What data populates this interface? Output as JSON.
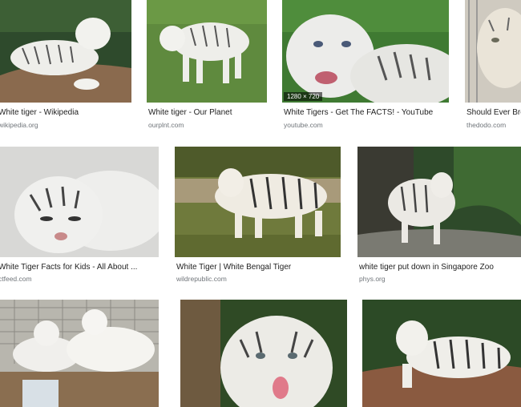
{
  "results": [
    {
      "title": "White tiger - Wikipedia",
      "source": "wikipedia.org"
    },
    {
      "title": "White tiger - Our Planet",
      "source": "ourplnt.com"
    },
    {
      "title": "White Tigers - Get The FACTS! - YouTube",
      "source": "youtube.com",
      "dimensions": "1280 × 720"
    },
    {
      "title": "Should Ever Bre",
      "source": "thedodo.com"
    },
    {
      "title": "White Tiger Facts for Kids - All About ...",
      "source": "ctfeed.com"
    },
    {
      "title": "White Tiger | White Bengal Tiger",
      "source": "wildrepublic.com"
    },
    {
      "title": "white tiger put down in Singapore Zoo",
      "source": "phys.org"
    },
    {
      "title": "",
      "source": ""
    },
    {
      "title": "",
      "source": ""
    },
    {
      "title": "",
      "source": ""
    }
  ],
  "colors": {
    "caption": "#222222",
    "source": "#70757a",
    "background": "#ffffff"
  }
}
